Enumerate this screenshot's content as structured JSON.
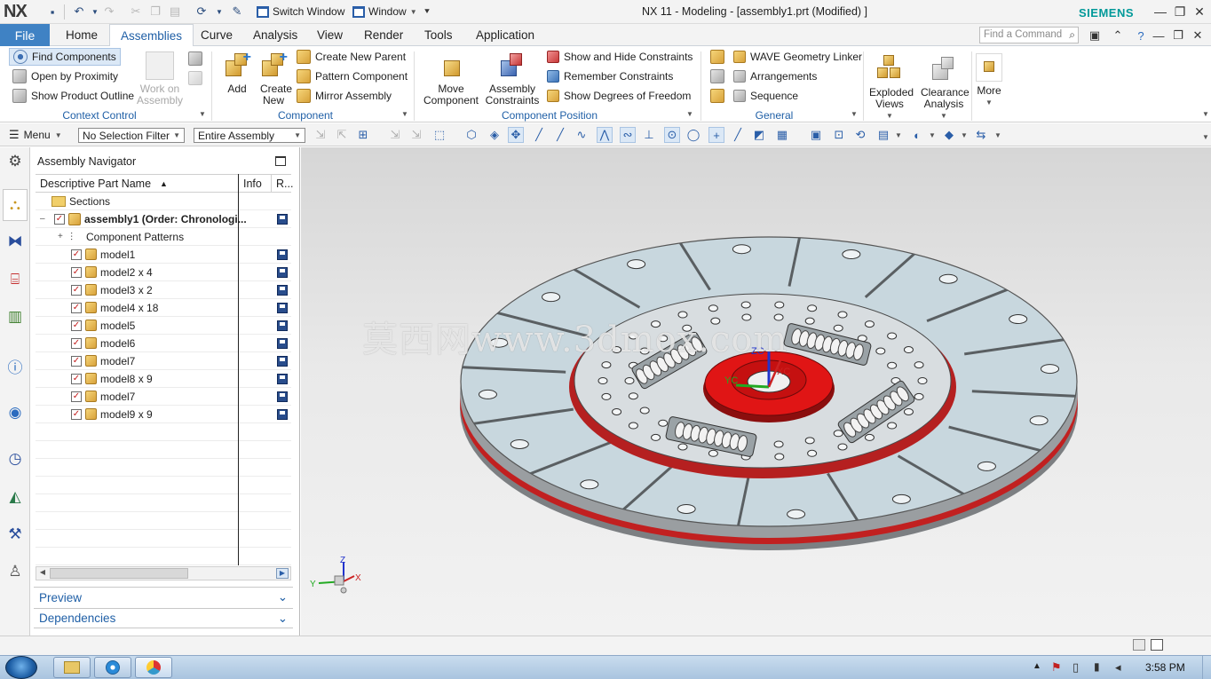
{
  "app": {
    "logo": "NX",
    "title": "NX 11 - Modeling - [assembly1.prt (Modified) ]",
    "brand": "SIEMENS",
    "switch_window": "Switch Window",
    "window_menu": "Window"
  },
  "menu": {
    "file": "File",
    "tabs": [
      "Home",
      "Assemblies",
      "Curve",
      "Analysis",
      "View",
      "Render",
      "Tools",
      "Application"
    ],
    "active_tab": "Assemblies",
    "find_placeholder": "Find a Command"
  },
  "ribbon": {
    "context_control": {
      "label": "Context Control",
      "find_components": "Find Components",
      "open_by_proximity": "Open by Proximity",
      "show_product_outline": "Show Product Outline",
      "work_on_assembly": "Work on Assembly"
    },
    "component": {
      "label": "Component",
      "add": "Add",
      "create_new": "Create New",
      "create_new_parent": "Create New Parent",
      "pattern_component": "Pattern Component",
      "mirror_assembly": "Mirror Assembly"
    },
    "component_position": {
      "label": "Component Position",
      "move_component": "Move Component",
      "assembly_constraints": "Assembly Constraints",
      "show_hide_constraints": "Show and Hide Constraints",
      "remember_constraints": "Remember Constraints",
      "show_dof": "Show Degrees of Freedom"
    },
    "general": {
      "label": "General",
      "wave_linker": "WAVE Geometry Linker",
      "arrangements": "Arrangements",
      "sequence": "Sequence"
    },
    "exploded_views": "Exploded Views",
    "clearance_analysis": "Clearance Analysis",
    "more": "More"
  },
  "selection_bar": {
    "menu": "Menu",
    "filter": "No Selection Filter",
    "scope": "Entire Assembly"
  },
  "navigator": {
    "title": "Assembly Navigator",
    "columns": [
      "Descriptive Part Name",
      "Info",
      "R..."
    ],
    "rows": [
      {
        "name": "Sections"
      },
      {
        "name": "assembly1 (Order: Chronologi..."
      },
      {
        "name": "Component Patterns"
      },
      {
        "name": "model1"
      },
      {
        "name": "model2 x 4"
      },
      {
        "name": "model3 x 2"
      },
      {
        "name": "model4 x 18"
      },
      {
        "name": "model5"
      },
      {
        "name": "model6"
      },
      {
        "name": "model7"
      },
      {
        "name": "model8 x 9"
      },
      {
        "name": "model7"
      },
      {
        "name": "model9 x 9"
      }
    ],
    "preview": "Preview",
    "dependencies": "Dependencies"
  },
  "viewport": {
    "watermark": "莫西网www.3dmox.com",
    "triad": {
      "x": "X",
      "y": "Y",
      "z": "Z"
    },
    "csys": {
      "xc": "XC",
      "yc": "YC",
      "zc": "ZC"
    },
    "colors": {
      "friction": "#dbe7ec",
      "hub": "#e01515",
      "plate": "#d6dcdf"
    }
  },
  "taskbar": {
    "time": "3:58 PM"
  }
}
